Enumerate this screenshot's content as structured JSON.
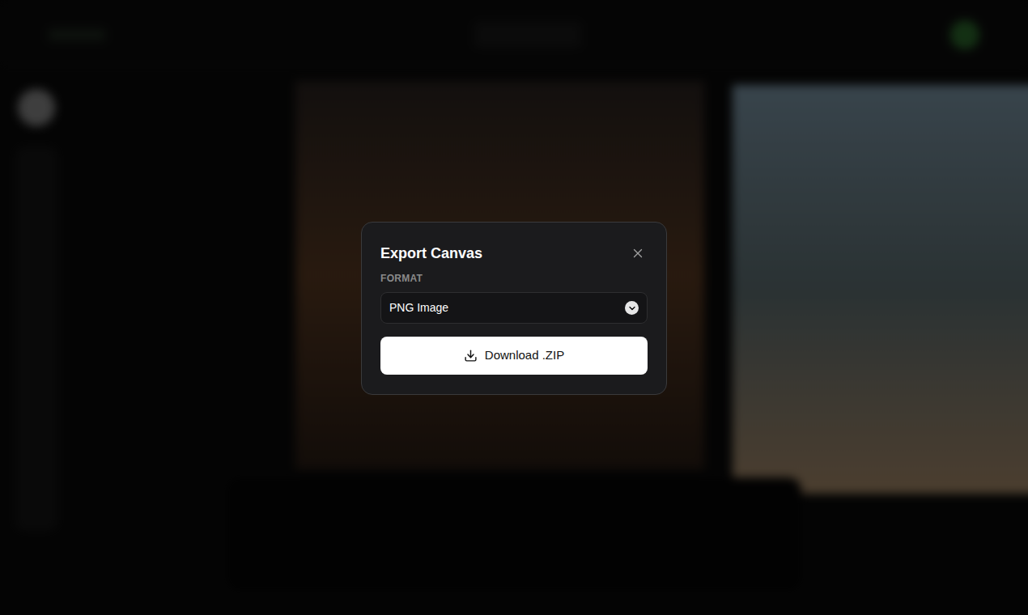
{
  "dialog": {
    "title": "Export Canvas",
    "format_label": "FORMAT",
    "format_value": "PNG Image",
    "download_button": "Download .ZIP"
  }
}
